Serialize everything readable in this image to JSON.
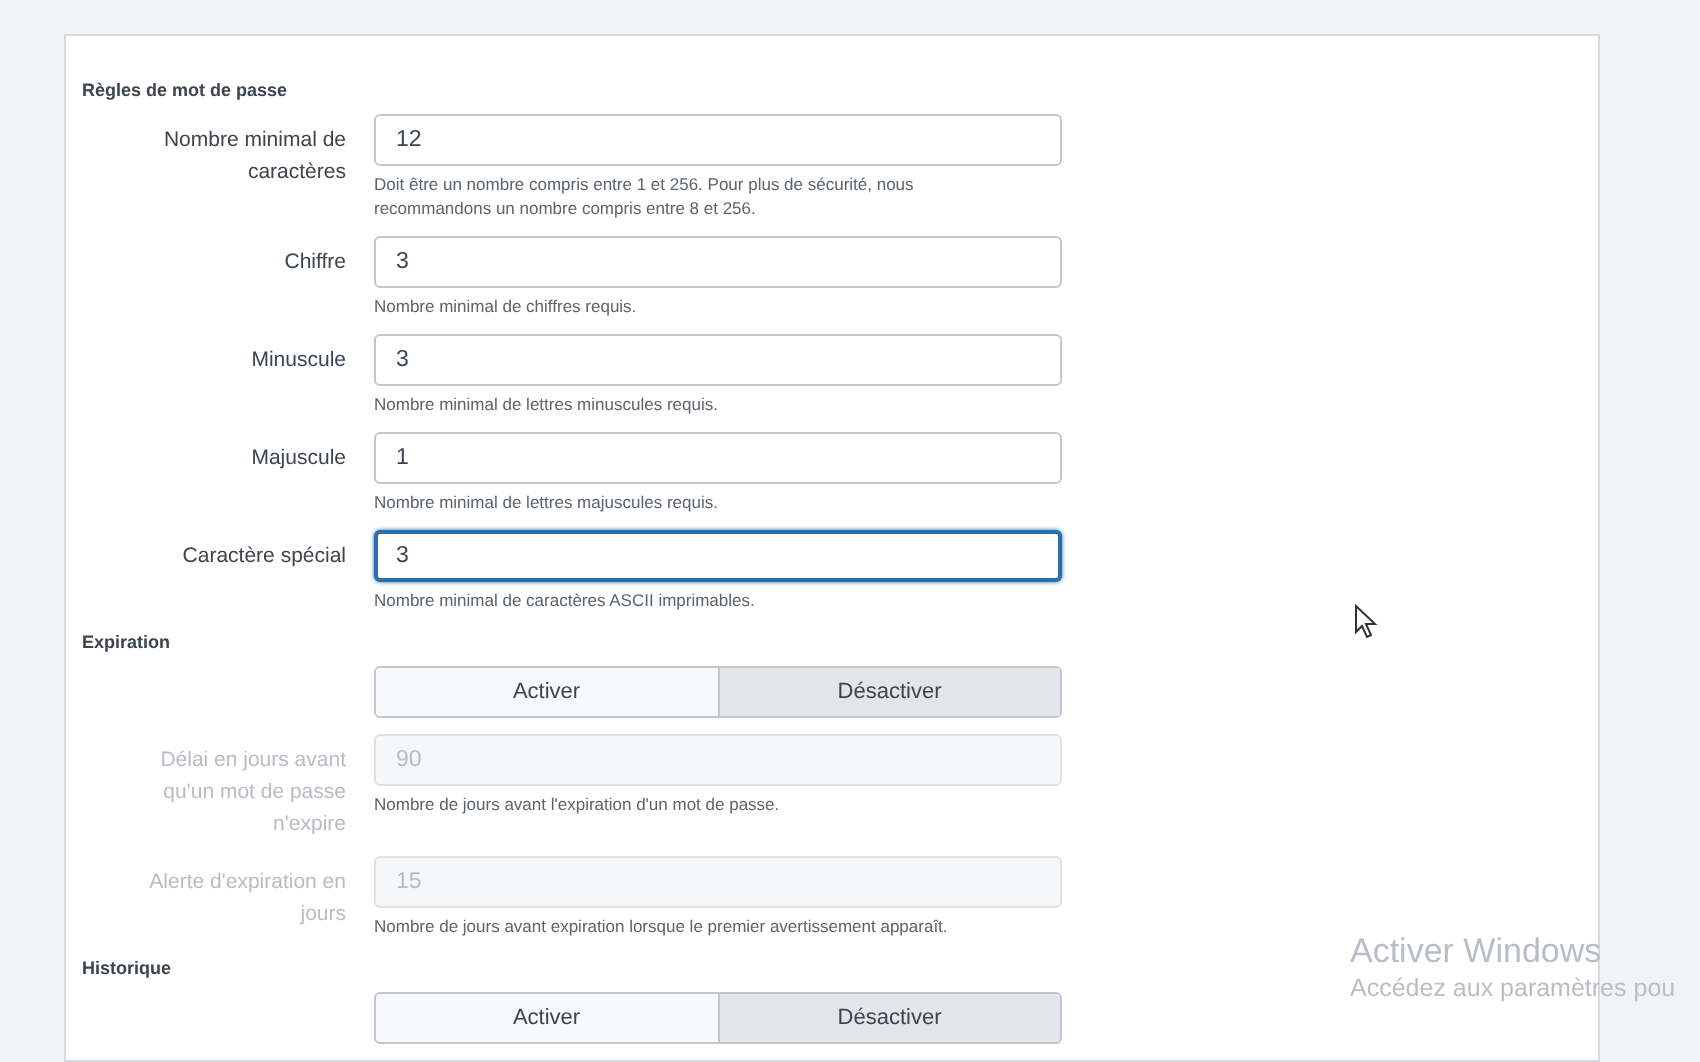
{
  "sections": [
    {
      "title": "Règles de mot de passe",
      "fields": [
        {
          "label": "Nombre minimal de caractères",
          "value": "12",
          "help": "Doit être un nombre compris entre 1 et 256. Pour plus de sécurité, nous recommandons un nombre compris entre 8 et 256.",
          "disabled": false,
          "focused": false
        },
        {
          "label": "Chiffre",
          "value": "3",
          "help": "Nombre minimal de chiffres requis.",
          "disabled": false,
          "focused": false
        },
        {
          "label": "Minuscule",
          "value": "3",
          "help": "Nombre minimal de lettres minuscules requis.",
          "disabled": false,
          "focused": false
        },
        {
          "label": "Majuscule",
          "value": "1",
          "help": "Nombre minimal de lettres majuscules requis.",
          "disabled": false,
          "focused": false
        },
        {
          "label": "Caractère spécial",
          "value": "3",
          "help": "Nombre minimal de caractères ASCII imprimables.",
          "disabled": false,
          "focused": true
        }
      ]
    },
    {
      "title": "Expiration",
      "toggle": [
        {
          "label": "Activer",
          "selected": false
        },
        {
          "label": "Désactiver",
          "selected": true
        }
      ],
      "fields": [
        {
          "label": "Délai en jours avant qu'un mot de passe n'expire",
          "value": "90",
          "help": "Nombre de jours avant l'expiration d'un mot de passe.",
          "disabled": true,
          "focused": false
        },
        {
          "label": "Alerte d'expiration en jours",
          "value": "15",
          "help": "Nombre de jours avant expiration lorsque le premier avertissement apparaît.",
          "disabled": true,
          "focused": false
        }
      ]
    },
    {
      "title": "Historique",
      "toggle": [
        {
          "label": "Activer",
          "selected": false
        },
        {
          "label": "Désactiver",
          "selected": true
        }
      ]
    }
  ],
  "os_overlay": {
    "title": "Activer Windows",
    "subtitle": "Accédez aux paramètres pou"
  }
}
